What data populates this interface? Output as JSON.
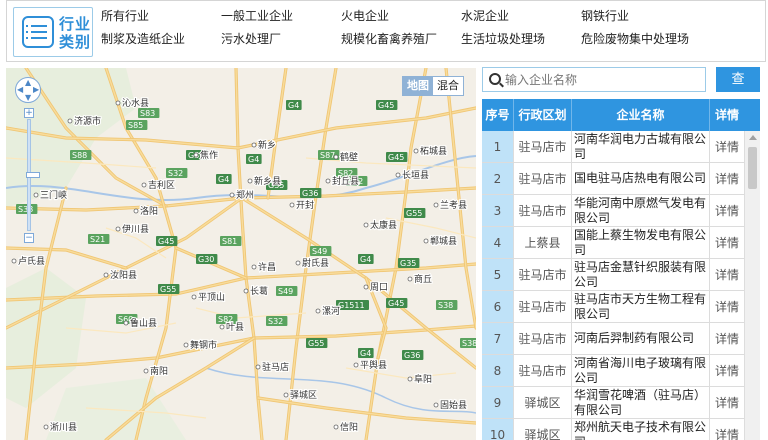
{
  "industry": {
    "title": "行业类别",
    "items": [
      "所有行业",
      "一般工业企业",
      "火电企业",
      "水泥企业",
      "钢铁行业",
      "制浆及造纸企业",
      "污水处理厂",
      "规模化畜禽养殖厂",
      "生活垃圾处理场",
      "危险废物集中处理场"
    ]
  },
  "map": {
    "tab_map": "地图",
    "tab_satellite": "混合",
    "highway_labels": [
      "G4",
      "G45",
      "S83",
      "S85",
      "S88",
      "G30",
      "G4",
      "S87",
      "G45",
      "S32",
      "S82",
      "G4",
      "G35",
      "G36",
      "G55",
      "S32",
      "S38",
      "S21",
      "G45",
      "S81",
      "S49",
      "G4",
      "G35",
      "G30",
      "G55",
      "S49",
      "G1511",
      "G45",
      "S38",
      "S60",
      "S82",
      "S32",
      "G55",
      "G4",
      "G36",
      "S38"
    ],
    "place_labels": [
      "沁水县",
      "济源市",
      "焦作",
      "新乡",
      "鹤壁",
      "濮阳",
      "吉利区",
      "新乡县",
      "封丘县",
      "长垣县",
      "三门峡",
      "洛阳",
      "郑州",
      "开封",
      "兰考县",
      "伊川县",
      "许昌",
      "尉氏县",
      "商丘",
      "平顶山",
      "长葛",
      "漯河",
      "周口",
      "南阳",
      "驻马店",
      "阜阳",
      "驿城区",
      "舞钢市",
      "信阳",
      "平舆县",
      "固始县",
      "鲁山县",
      "卢氏县",
      "淅川县",
      "叶县",
      "郸城县",
      "柘城县",
      "太康县",
      "汝阳县"
    ]
  },
  "search": {
    "placeholder": "输入企业名称",
    "button_label": "查 询"
  },
  "table": {
    "headers": [
      "序号",
      "行政区划",
      "企业名称",
      "详情"
    ],
    "rows": [
      {
        "no": "1",
        "region": "驻马店市",
        "name": "河南华润电力古城有限公司",
        "detail": "详情"
      },
      {
        "no": "2",
        "region": "驻马店市",
        "name": "国电驻马店热电有限公司",
        "detail": "详情"
      },
      {
        "no": "3",
        "region": "驻马店市",
        "name": "华能河南中原燃气发电有限公司",
        "detail": "详情"
      },
      {
        "no": "4",
        "region": "上蔡县",
        "name": "国能上蔡生物发电有限公司",
        "detail": "详情"
      },
      {
        "no": "5",
        "region": "驻马店市",
        "name": "驻马店金慧针织服装有限公司",
        "detail": "详情"
      },
      {
        "no": "6",
        "region": "驻马店市",
        "name": "驻马店市天方生物工程有限公司",
        "detail": "详情"
      },
      {
        "no": "7",
        "region": "驻马店市",
        "name": "河南后羿制药有限公司",
        "detail": "详情"
      },
      {
        "no": "8",
        "region": "驻马店市",
        "name": "河南省海川电子玻璃有限公司",
        "detail": "详情"
      },
      {
        "no": "9",
        "region": "驿城区",
        "name": "华润雪花啤酒（驻马店）有限公司",
        "detail": "详情"
      },
      {
        "no": "10",
        "region": "驿城区",
        "name": "郑州航天电子技术有限公司",
        "detail": "详情"
      }
    ]
  }
}
